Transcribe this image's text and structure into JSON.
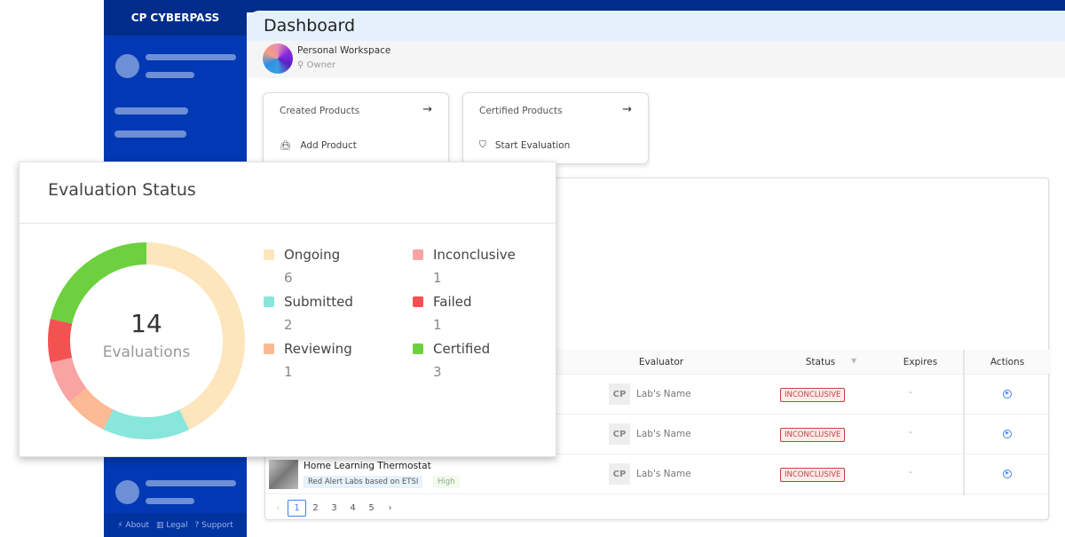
{
  "brand": "CYBERPASS",
  "header": {
    "title": "Dashboard"
  },
  "workspace": {
    "name": "Personal Workspace",
    "role": "Owner"
  },
  "cards": [
    {
      "title": "Created Products",
      "action": "Add Product"
    },
    {
      "title": "Certified Products",
      "action": "Start Evaluation"
    }
  ],
  "table": {
    "columns": {
      "evaluator": "Evaluator",
      "status": "Status",
      "expires": "Expires",
      "actions": "Actions"
    },
    "rows": [
      {
        "evaluator": "Lab's Name",
        "status": "INCONCLUSIVE",
        "expires": "-"
      },
      {
        "evaluator": "Lab's Name",
        "status": "INCONCLUSIVE",
        "expires": "-"
      },
      {
        "product": "Home Learning Thermostat",
        "scheme": "Red Alert Labs based on ETSI",
        "level": "High",
        "evaluator": "Lab's Name",
        "status": "INCONCLUSIVE",
        "expires": "-"
      }
    ],
    "pages": [
      "1",
      "2",
      "3",
      "4",
      "5"
    ],
    "current_page": "1"
  },
  "footer": {
    "about": "About",
    "legal": "Legal",
    "support": "Support"
  },
  "evaluation": {
    "title": "Evaluation Status",
    "total": "14",
    "total_label": "Evaluations"
  },
  "chart_data": {
    "type": "pie",
    "title": "Evaluation Status",
    "categories": [
      "Ongoing",
      "Submitted",
      "Reviewing",
      "Inconclusive",
      "Failed",
      "Certified"
    ],
    "values": [
      6,
      2,
      1,
      1,
      1,
      3
    ],
    "colors": [
      "#fde5bc",
      "#88e6dc",
      "#fbb994",
      "#f9a3a3",
      "#f25252",
      "#6dd03f"
    ]
  }
}
